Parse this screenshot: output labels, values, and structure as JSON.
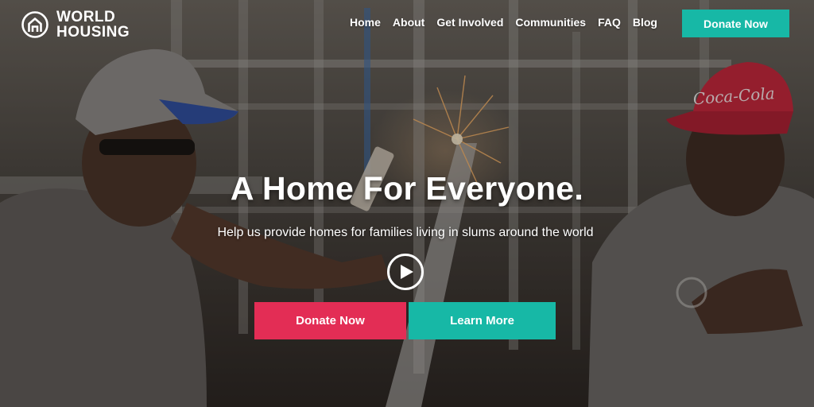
{
  "brand": {
    "line1": "WORLD",
    "line2": "HOUSING"
  },
  "nav": {
    "items": [
      {
        "label": "Home"
      },
      {
        "label": "About"
      },
      {
        "label": "Get Involved"
      },
      {
        "label": "Communities"
      },
      {
        "label": "FAQ"
      },
      {
        "label": "Blog"
      }
    ],
    "donate_label": "Donate Now"
  },
  "hero": {
    "headline": "A Home For Everyone.",
    "subheadline": "Help us provide homes for families living in slums around the world",
    "donate_label": "Donate Now",
    "learn_label": "Learn More"
  },
  "colors": {
    "accent_teal": "#17b8a6",
    "accent_red": "#e32d55",
    "text": "#ffffff"
  },
  "icons": {
    "logo": "house-in-circle-icon",
    "play": "play-icon"
  }
}
